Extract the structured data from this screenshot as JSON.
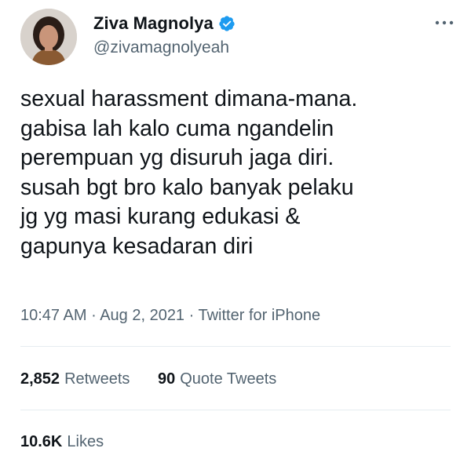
{
  "author": {
    "display_name": "Ziva Magnolya",
    "handle": "@zivamagnolyeah",
    "verified": true
  },
  "tweet": {
    "lines": [
      "sexual harassment dimana-mana.",
      "gabisa lah kalo cuma ngandelin",
      "perempuan yg disuruh jaga diri.",
      "susah bgt bro kalo banyak pelaku",
      "jg yg masi kurang edukasi &",
      "gapunya kesadaran diri"
    ],
    "time": "10:47 AM",
    "separator": " · ",
    "date": "Aug 2, 2021",
    "source": "Twitter for iPhone"
  },
  "stats": {
    "retweets_count": "2,852",
    "retweets_label": "Retweets",
    "quotes_count": "90",
    "quotes_label": "Quote Tweets",
    "likes_count": "10.6K",
    "likes_label": "Likes"
  },
  "icons": {
    "verified_badge": "verified-badge-icon",
    "more": "more-horizontal-icon"
  },
  "colors": {
    "verified_blue": "#1d9bf0",
    "secondary_text": "#536471",
    "divider": "#e6ecf0"
  }
}
